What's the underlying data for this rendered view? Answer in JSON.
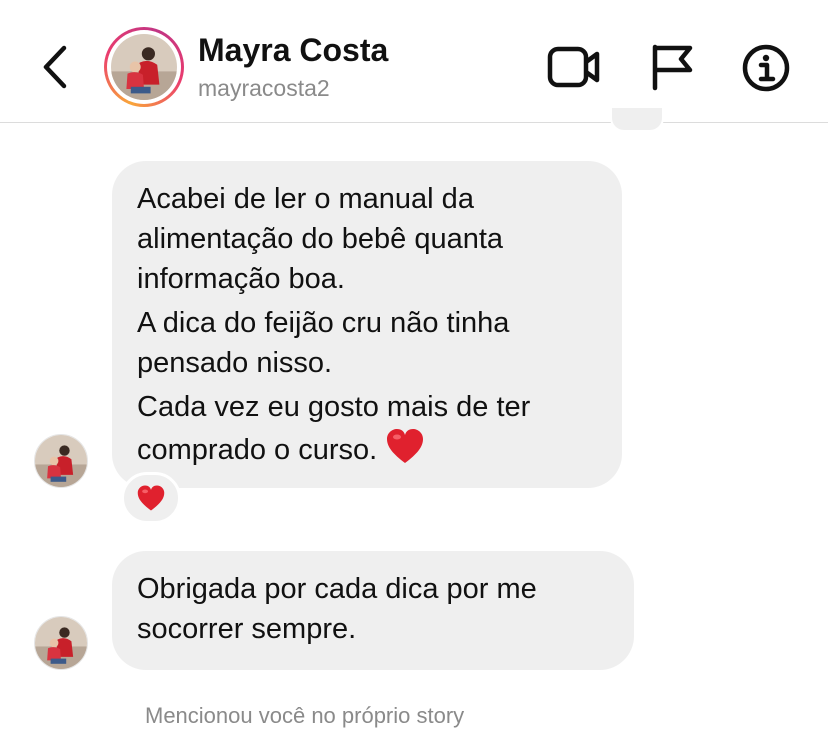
{
  "header": {
    "display_name": "Mayra Costa",
    "username": "mayracosta2",
    "icons": {
      "back": "chevron-left-icon",
      "video": "video-camera-icon",
      "flag": "flag-icon",
      "info": "info-icon"
    }
  },
  "messages": [
    {
      "sender": "Mayra Costa",
      "lines": [
        "Acabei de ler o manual da",
        "alimentação do bebê quanta",
        "informação boa."
      ],
      "lines2": [
        "A dica do feijão cru não tinha",
        "pensado nisso."
      ],
      "lines3": [
        "Cada vez eu gosto mais de ter",
        "comprado o curso."
      ],
      "emoji": "red-heart-icon",
      "reaction": "red-heart-icon"
    },
    {
      "sender": "Mayra Costa",
      "lines": [
        "Obrigada por cada dica por me",
        "socorrer sempre."
      ]
    }
  ],
  "mention_notice": "Mencionou você no próprio story",
  "colors": {
    "bubble": "#efefef",
    "secondary_text": "#8a8a8a",
    "heart": "#e0212e",
    "ring_start": "#f9a63a",
    "ring_end": "#c13584"
  }
}
